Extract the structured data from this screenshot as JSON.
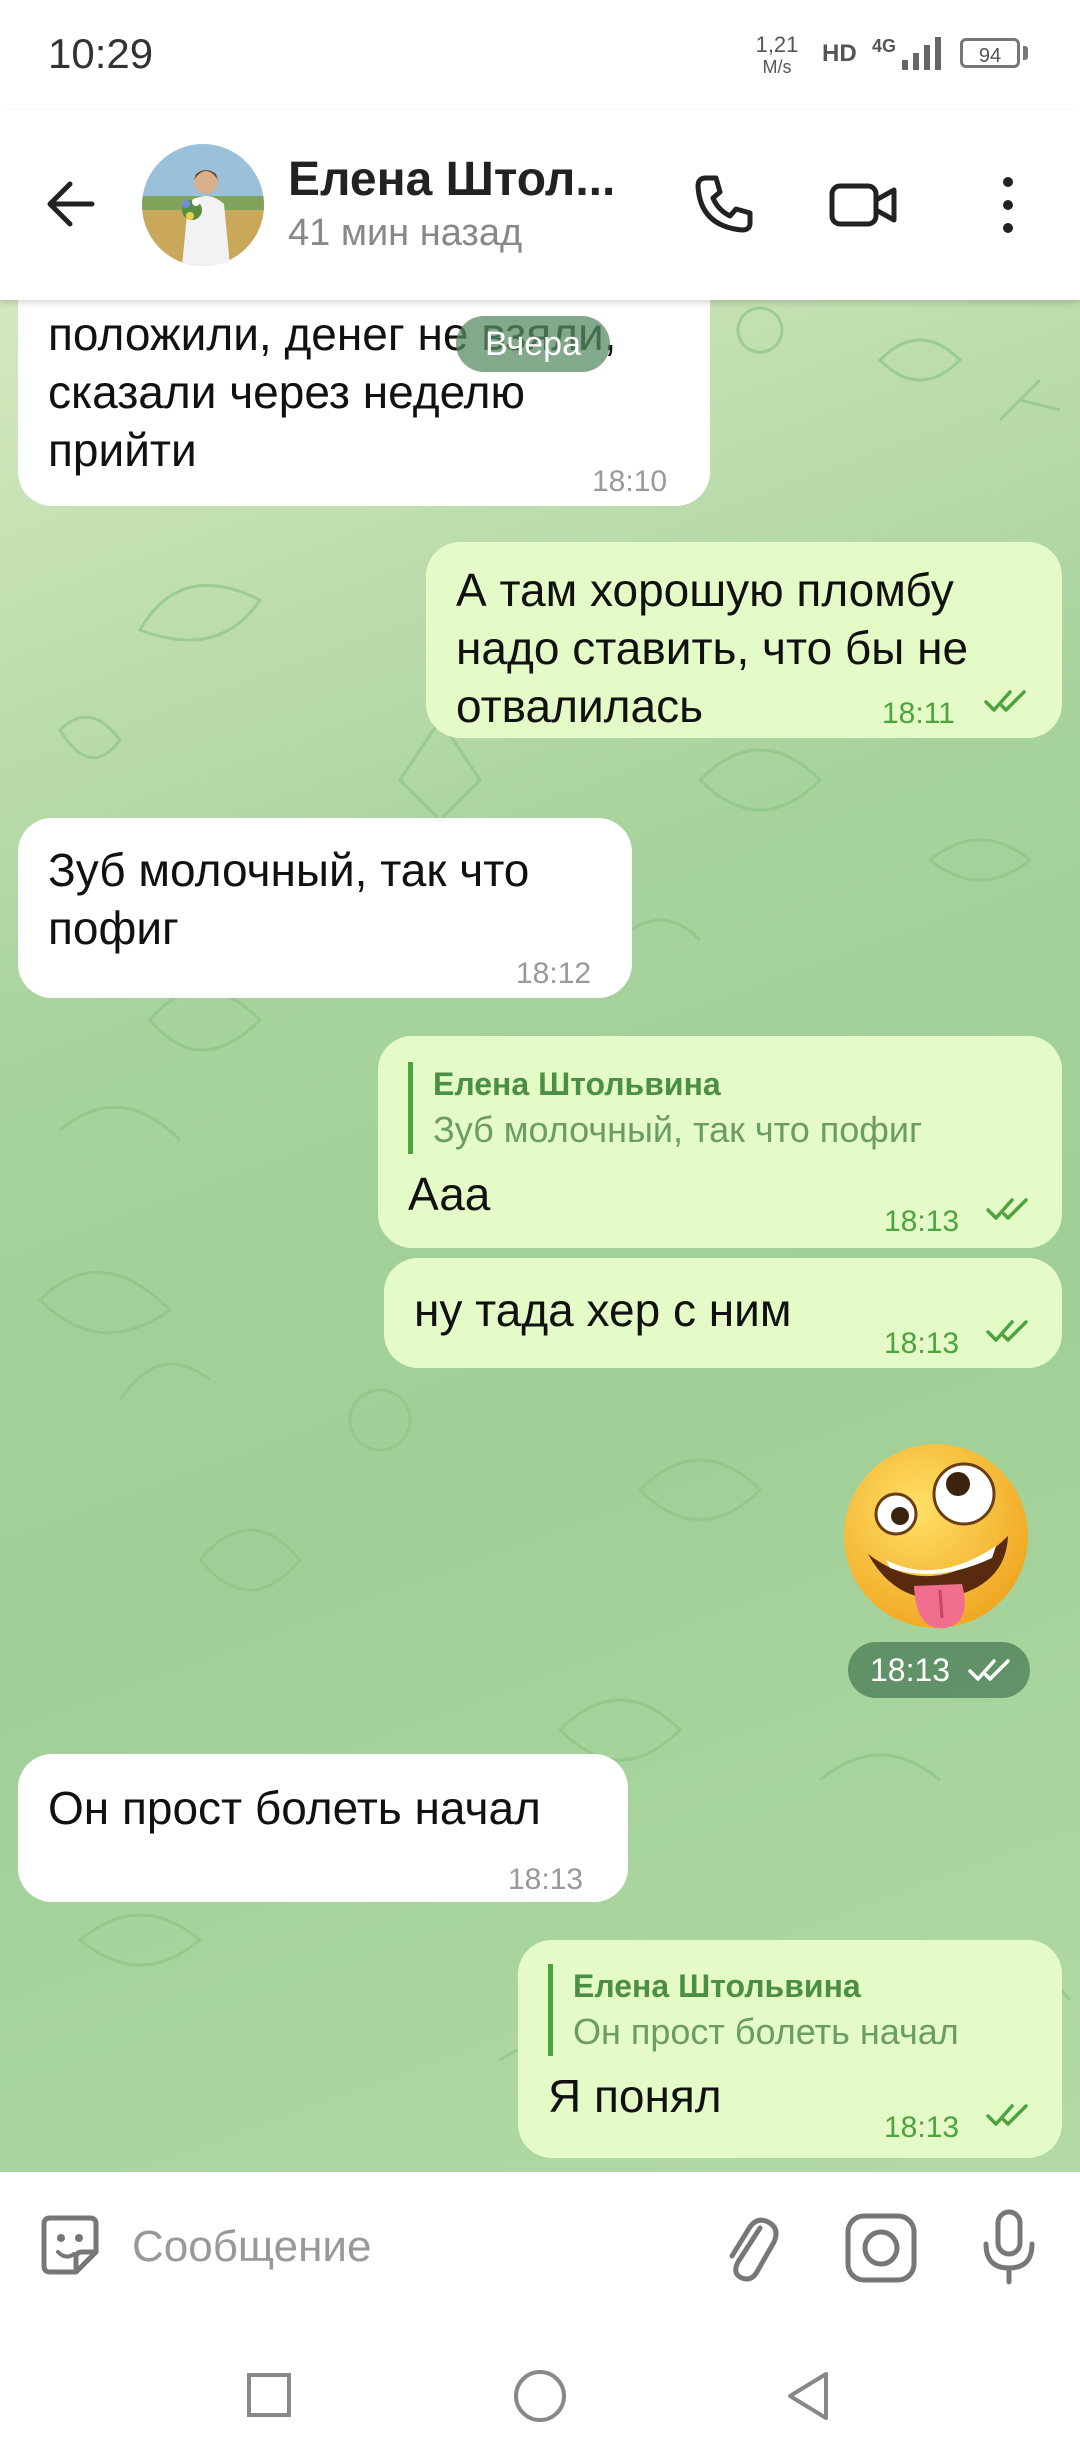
{
  "status_bar": {
    "time": "10:29",
    "net_speed_value": "1,21",
    "net_speed_unit": "M/s",
    "hd": "HD",
    "network": "4G",
    "battery": "94"
  },
  "header": {
    "contact_name": "Елена Штол...",
    "last_seen": "41 мин назад"
  },
  "chat": {
    "date_label": "Вчера",
    "messages": [
      {
        "direction": "in",
        "lines": [
          "положили, денег не взяли,",
          "сказали через неделю",
          "прийти"
        ],
        "time": "18:10"
      },
      {
        "direction": "out",
        "lines": [
          "А там хорошую пломбу",
          "надо ставить, что бы не",
          "отвалилась"
        ],
        "time": "18:11"
      },
      {
        "direction": "in",
        "lines": [
          "Зуб молочный,  так что",
          "пофиг"
        ],
        "time": "18:12"
      },
      {
        "direction": "out",
        "reply_to": {
          "name": "Елена Штольвина",
          "text": "Зуб молочный,  так что пофиг"
        },
        "lines": [
          "Ааа"
        ],
        "time": "18:13"
      },
      {
        "direction": "out",
        "lines": [
          "ну тада хер с ним"
        ],
        "time": "18:13"
      },
      {
        "direction": "out",
        "sticker": "zany-face-emoji",
        "time": "18:13"
      },
      {
        "direction": "in",
        "lines": [
          "Он прост болеть начал"
        ],
        "time": "18:13"
      },
      {
        "direction": "out",
        "reply_to": {
          "name": "Елена Штольвина",
          "text": "Он прост болеть начал"
        },
        "lines": [
          "Я понял"
        ],
        "time": "18:13"
      }
    ]
  },
  "input": {
    "placeholder": "Сообщение"
  },
  "colors": {
    "outgoing_bubble": "#e4fbc8",
    "incoming_bubble": "#ffffff",
    "accent_green": "#4ea33e"
  }
}
